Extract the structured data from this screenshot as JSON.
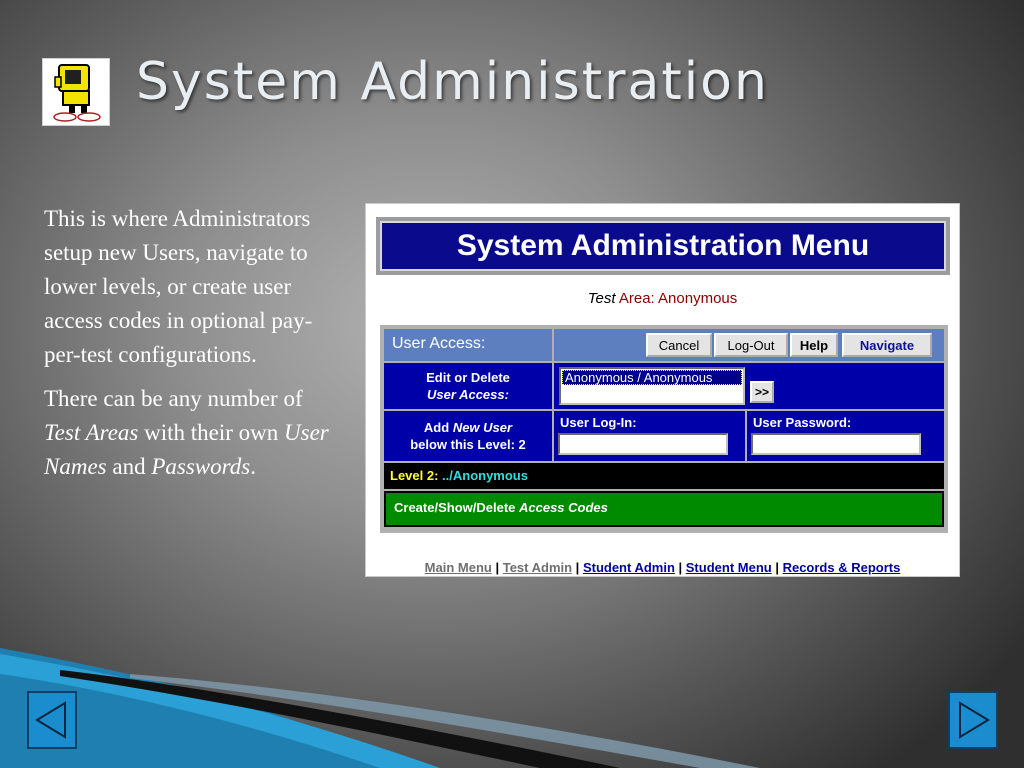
{
  "slide": {
    "title": "System Administration",
    "logo_icon": "yellow-robot-computer-icon",
    "paragraph1": "This is where Administrators setup new Users, navigate to lower levels, or create user access codes in optional pay-per-test configurations.",
    "p2_a": "There can be any number of ",
    "p2_b": "Test Areas",
    "p2_c": " with their own ",
    "p2_d": "User Names",
    "p2_e": " and ",
    "p2_f": "Passwords",
    "p2_g": "."
  },
  "panel": {
    "menu_title": "System Administration Menu",
    "area_italic": "Test",
    "area_rest": " Area: Anonymous",
    "user_access_label": "User Access:",
    "buttons": {
      "cancel": "Cancel",
      "logout": "Log-Out",
      "help": "Help",
      "navigate": "Navigate"
    },
    "edit_delete_line1": "Edit or Delete",
    "edit_delete_line2": "User Access:",
    "selected_user": "Anonymous / Anonymous",
    "go_button": ">>",
    "add_user_a": "Add ",
    "add_user_b": "New User",
    "add_user_line2": "below this Level: 2",
    "user_login_label": "User Log-In:",
    "user_password_label": "User Password:",
    "level_label": "Level 2:",
    "level_path": " ../Anonymous",
    "access_codes_a": "Create/Show/Delete ",
    "access_codes_b": "Access Codes",
    "footer_links": [
      "Main Menu",
      "Test Admin",
      "Student Admin",
      "Student Menu",
      "Records & Reports"
    ],
    "footer_separator": " | "
  },
  "nav": {
    "prev_icon": "left-triangle-icon",
    "next_icon": "right-triangle-icon"
  },
  "colors": {
    "menu_header_bg": "#0a0a8c",
    "label_blue": "#5e7fbf",
    "row_blue": "#0000a8",
    "level_bg": "#000000",
    "codes_bg": "#008a00",
    "nav_button": "#1b8ccd"
  }
}
